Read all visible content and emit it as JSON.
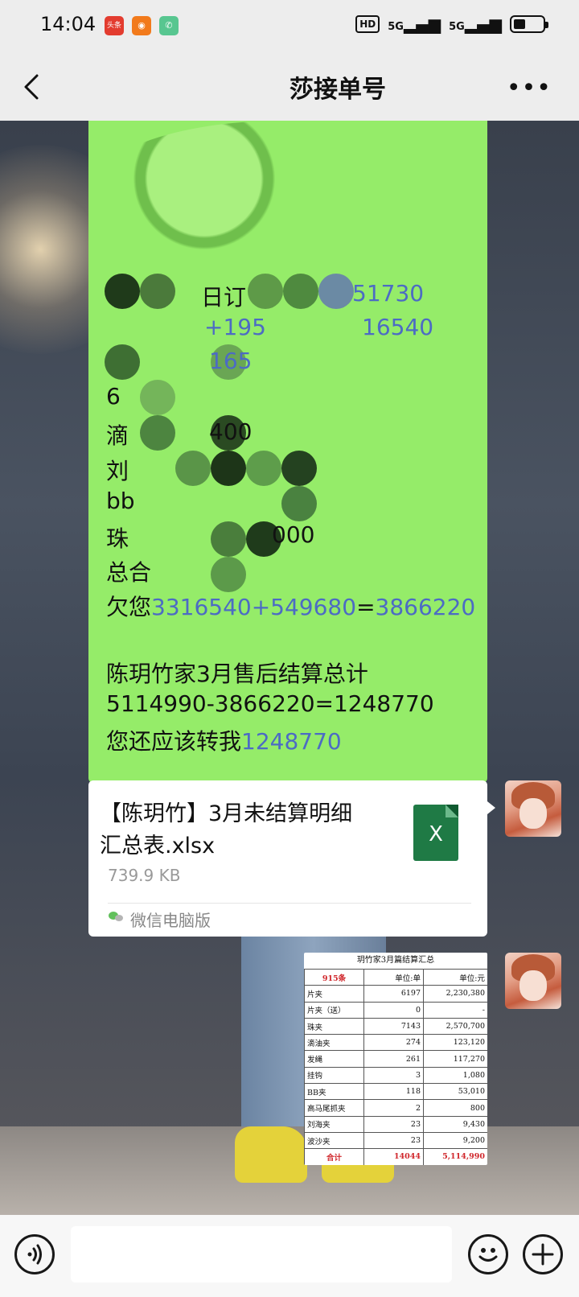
{
  "status_bar": {
    "time": "14:04",
    "app1_label": "头条",
    "hd_label": "HD",
    "signal1_label": "5G",
    "signal2_label": "5G"
  },
  "header": {
    "title": "莎接单号"
  },
  "message": {
    "partial_lines": [
      {
        "left": "日订",
        "right": "51730"
      },
      {
        "left": "+195",
        "right": "16540"
      },
      {
        "left": "165",
        "right": ""
      }
    ],
    "owe_prefix": "欠您",
    "owe_expr": "3316540+549680",
    "owe_eq": "=",
    "owe_result": "3866220",
    "summary_title": "陈玥竹家3月售后结算总计",
    "summary_calc": "5114990-3866220=1248770",
    "transfer_prefix": "您还应该转我",
    "transfer_amount": "1248770",
    "fragments": [
      "6",
      "滴",
      "刘",
      "bb",
      "珠",
      "总合",
      "400",
      "000"
    ]
  },
  "file": {
    "name": "【陈玥竹】3月未结算明细汇总表.xlsx",
    "size": "739.9 KB",
    "icon_letter": "X",
    "source": "微信电脑版"
  },
  "sheet": {
    "title": "玥竹家3月篇结算汇总",
    "header": [
      "915条",
      "单位:单",
      "单位:元"
    ],
    "rows": [
      [
        "片夹",
        "6197",
        "2,230,380"
      ],
      [
        "片夹（送）",
        "0",
        "-"
      ],
      [
        "珠夹",
        "7143",
        "2,570,700"
      ],
      [
        "滴油夹",
        "274",
        "123,120"
      ],
      [
        "发绳",
        "261",
        "117,270"
      ],
      [
        "挂钩",
        "3",
        "1,080"
      ],
      [
        "BB夹",
        "118",
        "53,010"
      ],
      [
        "高马尾抓夹",
        "2",
        "800"
      ],
      [
        "刘海夹",
        "23",
        "9,430"
      ],
      [
        "波沙夹",
        "23",
        "9,200"
      ]
    ],
    "total": [
      "合计",
      "14044",
      "5,114,990"
    ]
  },
  "colors": {
    "bubble_green": "#95ec69",
    "number_blue": "#4c6bc4",
    "excel_green": "#1f7a45"
  }
}
